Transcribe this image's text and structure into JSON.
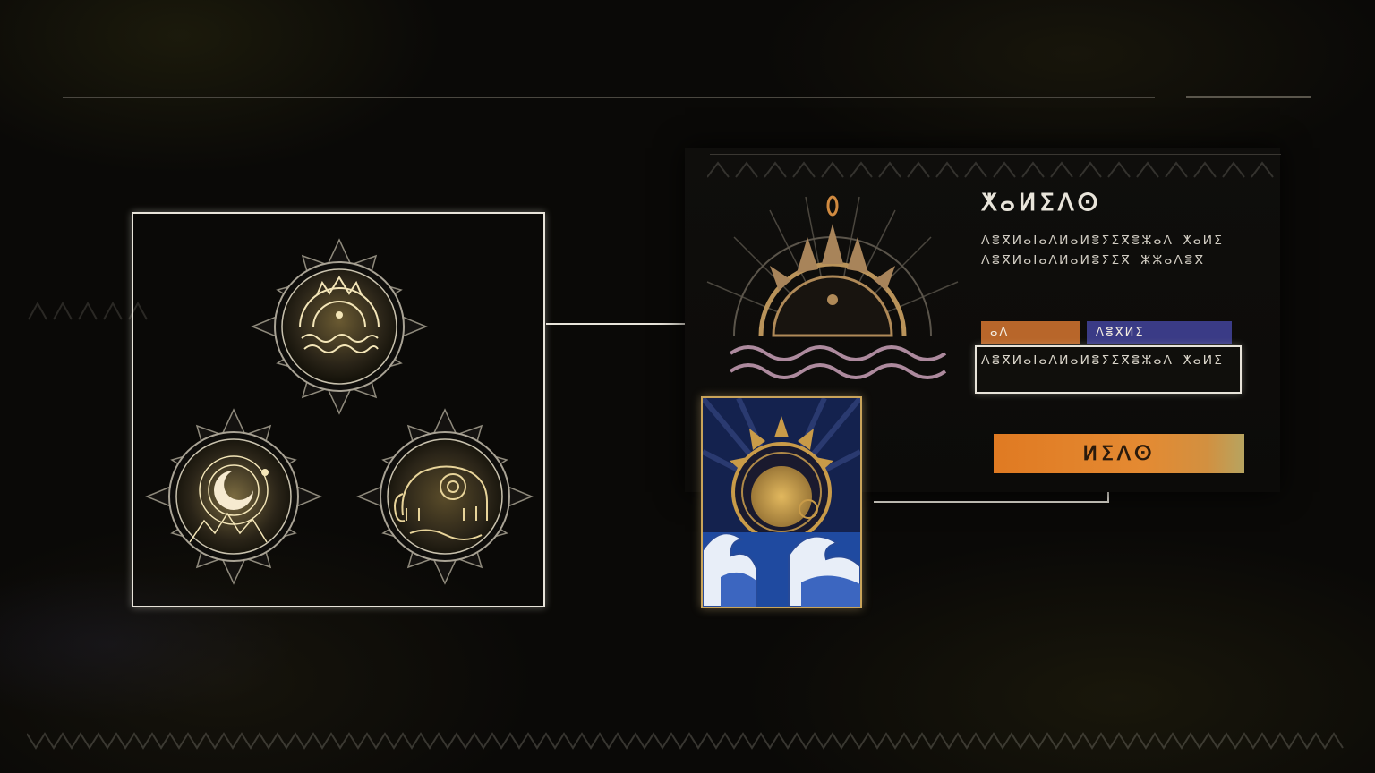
{
  "screen": {
    "selected_item": {
      "title": "ⵅⴰⵍⵉⴷⵙ",
      "description": "ⴷⴻⴳⵍⴰⵏⴰⴷⵍⴰⵍⴻⵢⵉⴳⴻⵣⴰⴷ ⵅⴰⵍⵉ ⴷⴻⴳⵍⴰⵏⴰⴷⵍⴰⵍⴻⵢⵉⴳ ⵣⵣⴰⴷⴻⴳ",
      "tags": [
        "ⴰⴷ",
        "ⴷⴻⴳⵍⵉ"
      ],
      "highlighted_text": "ⴷⴻⴳⵍⴰⵏⴰⴷⵍⴰⵍⴻⵢⵉⴳⴻⵣⴰⴷ ⵅⴰⵍⵉ",
      "action_label": "ⵍⵉⴷⵙ"
    },
    "emblems": [
      {
        "name": "sun-over-waves-emblem-icon"
      },
      {
        "name": "crescent-moon-emblem-icon"
      },
      {
        "name": "elephant-emblem-icon"
      }
    ],
    "card": {
      "name": "sun-and-waves-card"
    },
    "colors": {
      "gold": "#c9a45a",
      "frame": "#e8e4da",
      "tag_orange": "#b8662a",
      "tag_blue": "#3a3b86",
      "action": "#e07a22",
      "card_blue": "#1b2a5c"
    }
  }
}
